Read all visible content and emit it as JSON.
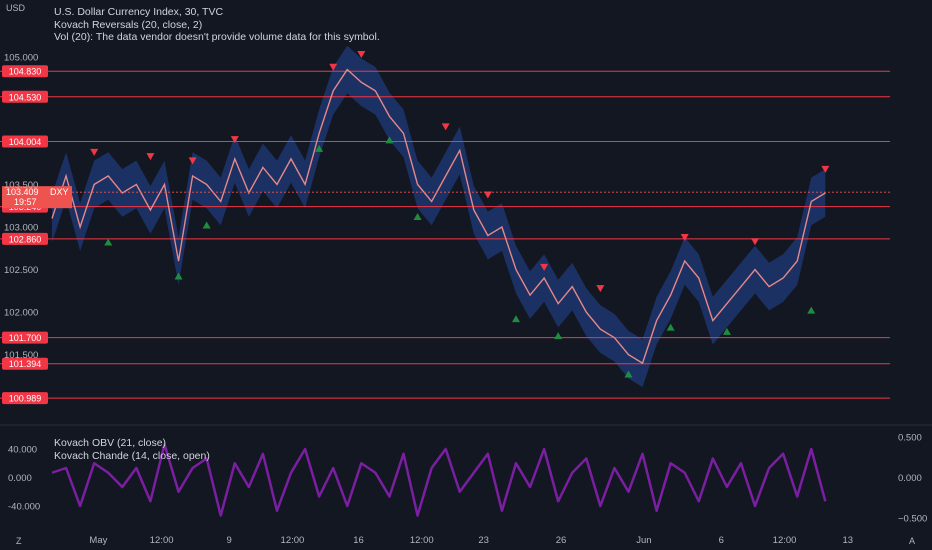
{
  "currency_label": "USD",
  "legend": {
    "line1": "U.S. Dollar Currency Index, 30, TVC",
    "line2": "Kovach Reversals (20, close, 2)",
    "line3": "Vol (20): The data vendor doesn't provide volume data for this symbol.",
    "line4": "Kovach OBV (21, close)",
    "line5": "Kovach Chande (14, close, open)"
  },
  "corner_left": "Z",
  "corner_right": "A",
  "colors": {
    "background": "#131722",
    "level_line": "#f23645",
    "band": "#1f3a7a",
    "price_up": "#d1d4dc",
    "price_down": "#ef5350",
    "reversal_top": "#f23645",
    "reversal_bottom": "#1e8e3e",
    "oscillator": "#7b1fa2"
  },
  "chart_data": [
    {
      "type": "line",
      "name": "price",
      "y_ticks": [
        "105.000",
        "103.500",
        "103.000",
        "102.500",
        "102.000",
        "101.500"
      ],
      "ylim": [
        100.85,
        105.15
      ],
      "x_ticks": [
        "May",
        "12:00",
        "9",
        "12:00",
        "16",
        "12:00",
        "23",
        "26",
        "Jun",
        "6",
        "12:00",
        "13"
      ],
      "x_tick_pos": [
        3.3,
        7.8,
        12.6,
        17.1,
        21.8,
        26.3,
        30.7,
        36.2,
        42.1,
        47.6,
        52.1,
        56.6
      ],
      "xlim": [
        0,
        59.6
      ],
      "horizontal_levels": [
        "104.830",
        "104.530",
        "104.004",
        "103.240",
        "102.860",
        "101.700",
        "101.394",
        "100.989"
      ],
      "last_price": {
        "symbol": "DXY",
        "value": "103.409",
        "countdown": "19:57"
      },
      "series": [
        {
          "x": [
            0,
            1,
            2,
            3,
            4,
            5,
            6,
            7,
            8,
            9,
            10,
            11,
            12,
            13,
            14,
            15,
            16,
            17,
            18,
            19,
            20,
            21,
            22,
            23,
            24,
            25,
            26,
            27,
            28,
            29,
            30,
            31,
            32,
            33,
            34,
            35,
            36,
            37,
            38,
            39,
            40,
            41,
            42,
            43,
            44,
            45,
            46,
            47,
            48,
            49,
            50,
            51,
            52,
            53,
            54,
            55
          ],
          "values": [
            103.1,
            103.6,
            103.0,
            103.5,
            103.6,
            103.4,
            103.5,
            103.2,
            103.5,
            102.6,
            103.6,
            103.5,
            103.3,
            103.8,
            103.4,
            103.7,
            103.5,
            103.8,
            103.5,
            104.1,
            104.6,
            104.85,
            104.7,
            104.6,
            104.3,
            104.1,
            103.5,
            103.3,
            103.6,
            103.9,
            103.2,
            102.9,
            103.0,
            102.5,
            102.2,
            102.4,
            102.1,
            102.3,
            102.0,
            101.8,
            101.7,
            101.5,
            101.4,
            101.9,
            102.2,
            102.6,
            102.4,
            101.9,
            102.1,
            102.3,
            102.5,
            102.3,
            102.4,
            102.6,
            103.3,
            103.4
          ]
        }
      ],
      "reversal_tops": [
        [
          3,
          103.8
        ],
        [
          7,
          103.75
        ],
        [
          10,
          103.7
        ],
        [
          13,
          103.95
        ],
        [
          20,
          104.8
        ],
        [
          22,
          104.95
        ],
        [
          28,
          104.1
        ],
        [
          31,
          103.3
        ],
        [
          35,
          102.45
        ],
        [
          39,
          102.2
        ],
        [
          45,
          102.8
        ],
        [
          50,
          102.75
        ],
        [
          55,
          103.6
        ]
      ],
      "reversal_bottoms": [
        [
          4,
          102.9
        ],
        [
          9,
          102.5
        ],
        [
          11,
          103.1
        ],
        [
          19,
          104.0
        ],
        [
          24,
          104.1
        ],
        [
          26,
          103.2
        ],
        [
          33,
          102.0
        ],
        [
          36,
          101.8
        ],
        [
          41,
          101.35
        ],
        [
          44,
          101.9
        ],
        [
          48,
          101.85
        ],
        [
          54,
          102.1
        ]
      ]
    },
    {
      "type": "line",
      "name": "oscillator",
      "left_ticks": [
        "40.000",
        "0.000",
        "-40.000"
      ],
      "right_ticks": [
        "0.500",
        "0.000",
        "−0.500"
      ],
      "ylim": [
        -1,
        1
      ],
      "series": [
        {
          "x": [
            0,
            1,
            2,
            3,
            4,
            5,
            6,
            7,
            8,
            9,
            10,
            11,
            12,
            13,
            14,
            15,
            16,
            17,
            18,
            19,
            20,
            21,
            22,
            23,
            24,
            25,
            26,
            27,
            28,
            29,
            30,
            31,
            32,
            33,
            34,
            35,
            36,
            37,
            38,
            39,
            40,
            41,
            42,
            43,
            44,
            45,
            46,
            47,
            48,
            49,
            50,
            51,
            52,
            53,
            54,
            55
          ],
          "values": [
            0.1,
            0.2,
            -0.6,
            0.3,
            0.1,
            -0.2,
            0.2,
            -0.5,
            0.7,
            -0.3,
            0.2,
            0.4,
            -0.8,
            0.3,
            -0.2,
            0.5,
            -0.7,
            0.1,
            0.6,
            -0.4,
            0.2,
            -0.6,
            0.3,
            0.1,
            -0.4,
            0.5,
            -0.8,
            0.2,
            0.6,
            -0.3,
            0.1,
            0.5,
            -0.7,
            0.3,
            -0.2,
            0.6,
            -0.5,
            0.1,
            0.4,
            -0.6,
            0.2,
            -0.3,
            0.5,
            -0.7,
            0.3,
            0.1,
            -0.5,
            0.4,
            -0.2,
            0.3,
            -0.6,
            0.2,
            0.5,
            -0.4,
            0.6,
            -0.5
          ]
        }
      ]
    }
  ]
}
